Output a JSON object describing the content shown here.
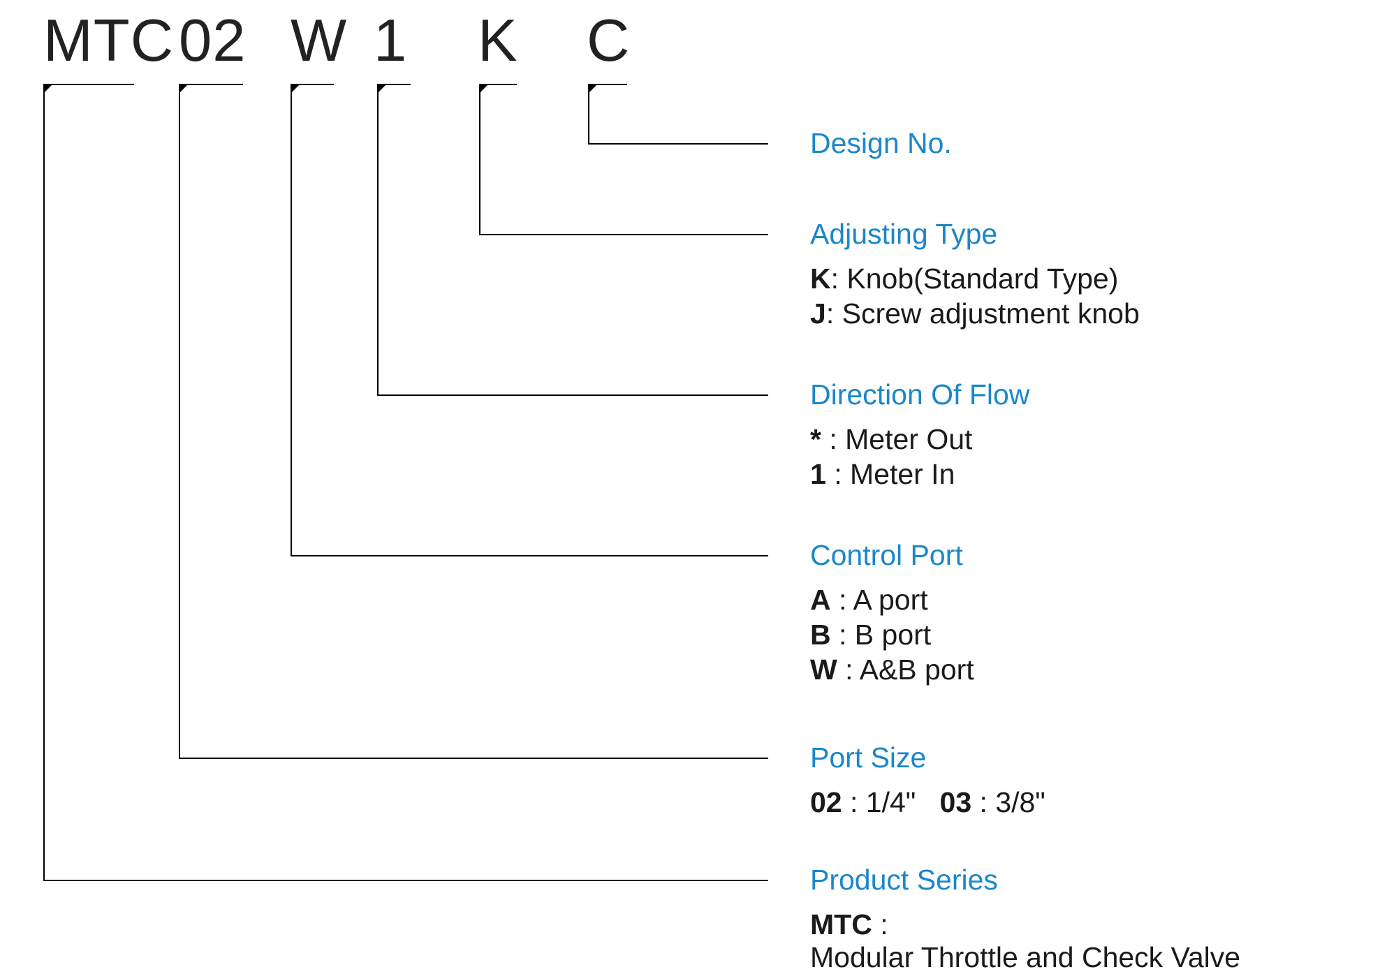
{
  "code": {
    "seg1": "MTC",
    "seg2": "02",
    "seg3": "W",
    "seg4": "1",
    "seg5": "K",
    "seg6": "C"
  },
  "sections": {
    "design_no": {
      "title": "Design No."
    },
    "adjusting_type": {
      "title": "Adjusting Type",
      "opt1_key": "K",
      "opt1_val": ": Knob(Standard Type)",
      "opt2_key": "J",
      "opt2_val": ": Screw adjustment knob"
    },
    "direction_of_flow": {
      "title": "Direction Of Flow",
      "opt1_key": "*",
      "opt1_val": " : Meter Out",
      "opt2_key": "1",
      "opt2_val": " : Meter In"
    },
    "control_port": {
      "title": "Control Port",
      "opt1_key": "A",
      "opt1_val": " :  A port",
      "opt2_key": "B",
      "opt2_val": " :  B port",
      "opt3_key": "W",
      "opt3_val": " : A&B port"
    },
    "port_size": {
      "title": "Port Size",
      "opt_line_key1": "02",
      "opt_line_val1": " : 1/4\"",
      "opt_line_key2": "03",
      "opt_line_val2": " : 3/8\""
    },
    "product_series": {
      "title": "Product Series",
      "opt_key": "MTC",
      "opt_val": " :",
      "subline": "Modular Throttle and Check Valve"
    }
  }
}
